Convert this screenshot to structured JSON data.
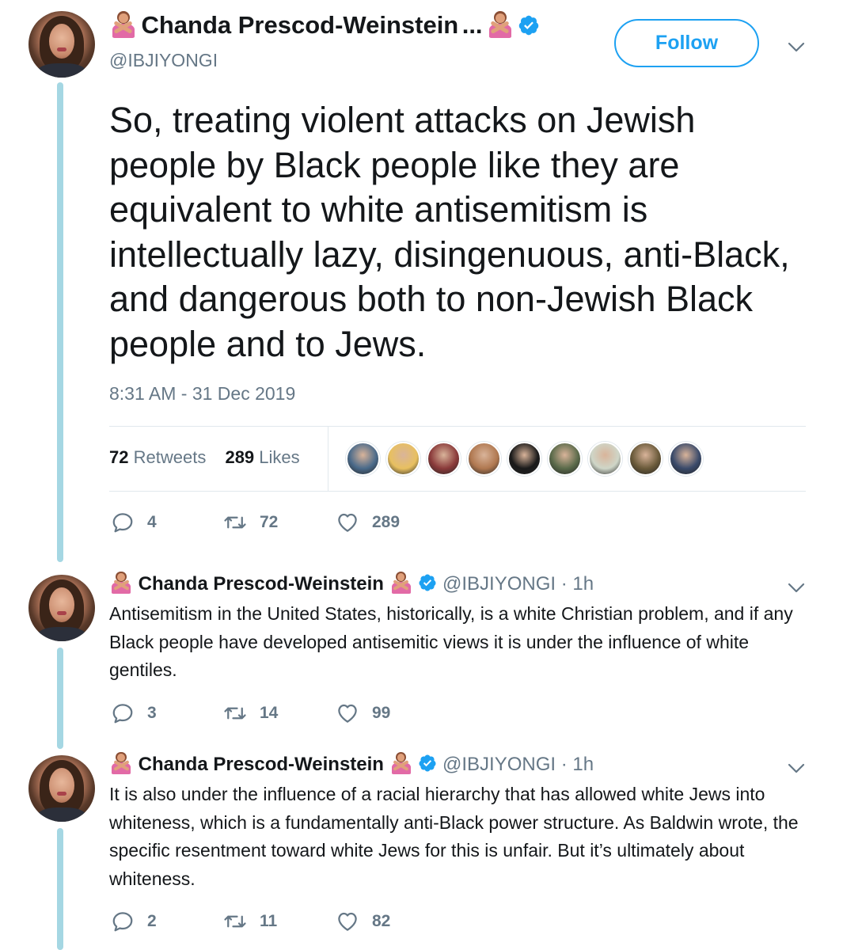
{
  "main_tweet": {
    "name": "Chanda Prescod-Weinstein",
    "name_suffix": "...",
    "handle": "@IBJIYONGI",
    "follow_label": "Follow",
    "text": "So, treating violent attacks on Jewish people by Black people like they are equivalent to white antisemitism is intellectually lazy, disingenuous, anti-Black, and dangerous both to non-Jewish Black people and to Jews.",
    "timestamp": "8:31 AM - 31 Dec 2019",
    "retweets_count": "72",
    "retweets_label": "Retweets",
    "likes_count": "289",
    "likes_label": "Likes",
    "replies": "4",
    "retweets": "72",
    "likes": "289",
    "liker_colors": [
      "#4a6a8a",
      "#e8c060",
      "#8a3a3a",
      "#b07850",
      "#1a1a1a",
      "#5a6a4a",
      "#cfd6c8",
      "#6a5a3a",
      "#3a4a6a"
    ]
  },
  "replies": [
    {
      "name": "Chanda Prescod-Weinstein",
      "handle": "@IBJIYONGI · 1h",
      "text": "Antisemitism in the United States, historically, is a white Christian problem, and if any Black people have developed antisemitic views it is under the influence of white gentiles.",
      "replies": "3",
      "retweets": "14",
      "likes": "99"
    },
    {
      "name": "Chanda Prescod-Weinstein",
      "handle": "@IBJIYONGI · 1h",
      "text": "It is also under the influence of a racial hierarchy that has allowed white Jews into whiteness, which is a fundamentally anti-Black power structure. As Baldwin wrote, the specific resentment toward white Jews for this is unfair. But it’s ultimately about whiteness.",
      "replies": "2",
      "retweets": "11",
      "likes": "82"
    }
  ],
  "colors": {
    "accent": "#1da1f2",
    "thread_line": "#a5d7e3",
    "secondary_text": "#657786"
  },
  "icons": [
    "reply-icon",
    "retweet-icon",
    "like-icon",
    "verified-icon",
    "chevron-down-icon",
    "emoji-no-gesture-icon"
  ]
}
